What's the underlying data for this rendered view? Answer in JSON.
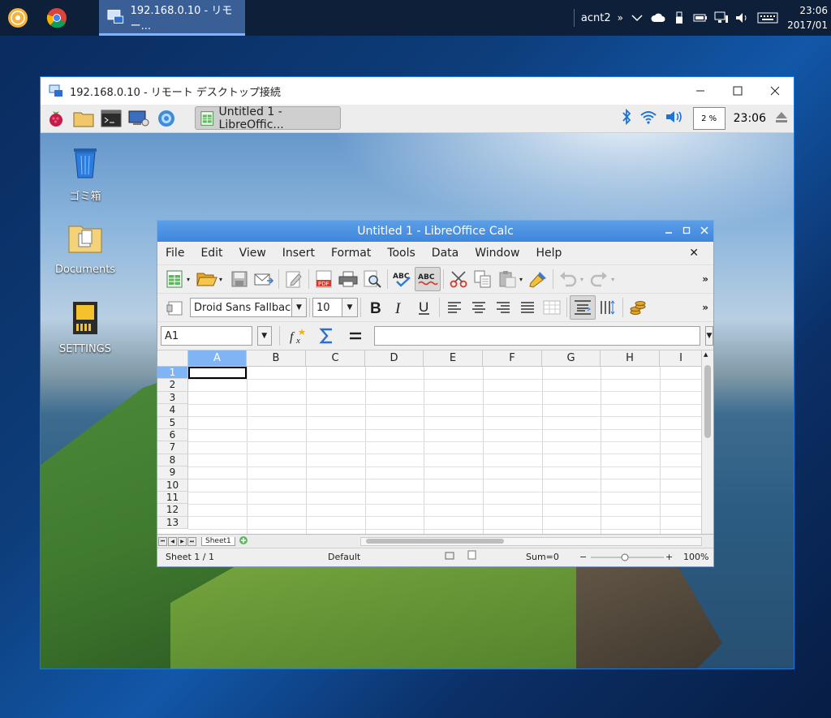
{
  "taskbar": {
    "app_title": "192.168.0.10 - リモー...",
    "user": "acnt2",
    "clock_time": "23:06",
    "clock_date": "2017/01"
  },
  "rdp": {
    "title": "192.168.0.10 - リモート デスクトップ接続",
    "panel": {
      "task_label": "Untitled 1 - LibreOffic...",
      "cpu_label": "2 %",
      "time": "23:06"
    },
    "desktop_icons": [
      {
        "label": "ゴミ箱",
        "icon": "trash-icon"
      },
      {
        "label": "Documents",
        "icon": "folder-icon"
      },
      {
        "label": "SETTINGS",
        "icon": "sd-card-icon"
      }
    ]
  },
  "calc": {
    "title": "Untitled 1 - LibreOffice Calc",
    "menu": [
      "File",
      "Edit",
      "View",
      "Insert",
      "Format",
      "Tools",
      "Data",
      "Window",
      "Help"
    ],
    "font_name": "Droid Sans Fallback",
    "font_size": "10",
    "cell_ref": "A1",
    "formula_value": "",
    "columns": [
      "A",
      "B",
      "C",
      "D",
      "E",
      "F",
      "G",
      "H",
      "I"
    ],
    "rows": [
      "1",
      "2",
      "3",
      "4",
      "5",
      "6",
      "7",
      "8",
      "9",
      "10",
      "11",
      "12",
      "13"
    ],
    "sheet_tab": "Sheet1",
    "status": {
      "sheet": "Sheet 1 / 1",
      "style": "Default",
      "sum": "Sum=0",
      "zoom": "100%"
    }
  },
  "colors": {
    "accent": "#3f86dc",
    "selected_header": "#7fb5f5"
  }
}
